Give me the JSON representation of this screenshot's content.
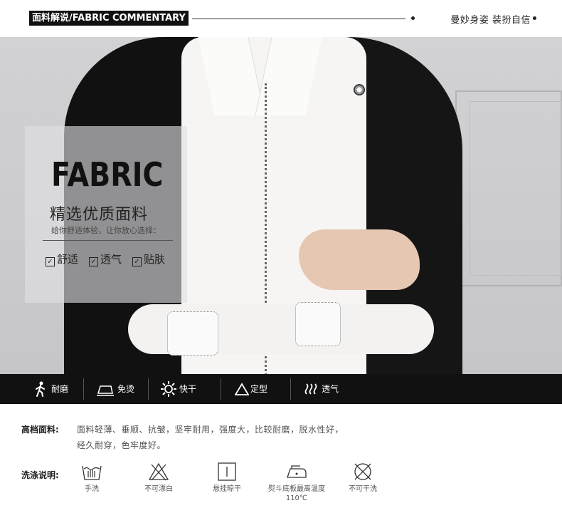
{
  "header": {
    "tag": "面料解说/FABRIC COMMENTARY",
    "slogan": "曼妙身姿 装扮自信"
  },
  "panel": {
    "heading": "FABRIC",
    "title": "精选优质面料",
    "subtitle": "给你舒适体验，让你放心选择：",
    "features": [
      "舒适",
      "透气",
      "贴肤"
    ]
  },
  "properties": [
    {
      "icon": "walking-person-icon",
      "label": "耐磨"
    },
    {
      "icon": "iron-icon",
      "label": "免烫"
    },
    {
      "icon": "sun-icon",
      "label": "快干"
    },
    {
      "icon": "triangle-icon",
      "label": "定型"
    },
    {
      "icon": "wave-icon",
      "label": "透气"
    }
  ],
  "fabric_info": {
    "label": "高档面料:",
    "line1": "面料轻薄、垂顺、抗皱，坚牢耐用，强度大，比较耐磨，脱水性好，",
    "line2": "经久耐穿，色牢度好。"
  },
  "wash_info": {
    "label": "洗涤说明:",
    "items": [
      {
        "icon": "hand-wash-icon",
        "label": "手洗"
      },
      {
        "icon": "no-bleach-icon",
        "label": "不可漂白"
      },
      {
        "icon": "hang-dry-icon",
        "label": "悬挂晾干"
      },
      {
        "icon": "iron-temp-icon",
        "label": "熨斗底板最高温度110℃"
      },
      {
        "icon": "no-dry-clean-icon",
        "label": "不可干洗"
      }
    ]
  }
}
